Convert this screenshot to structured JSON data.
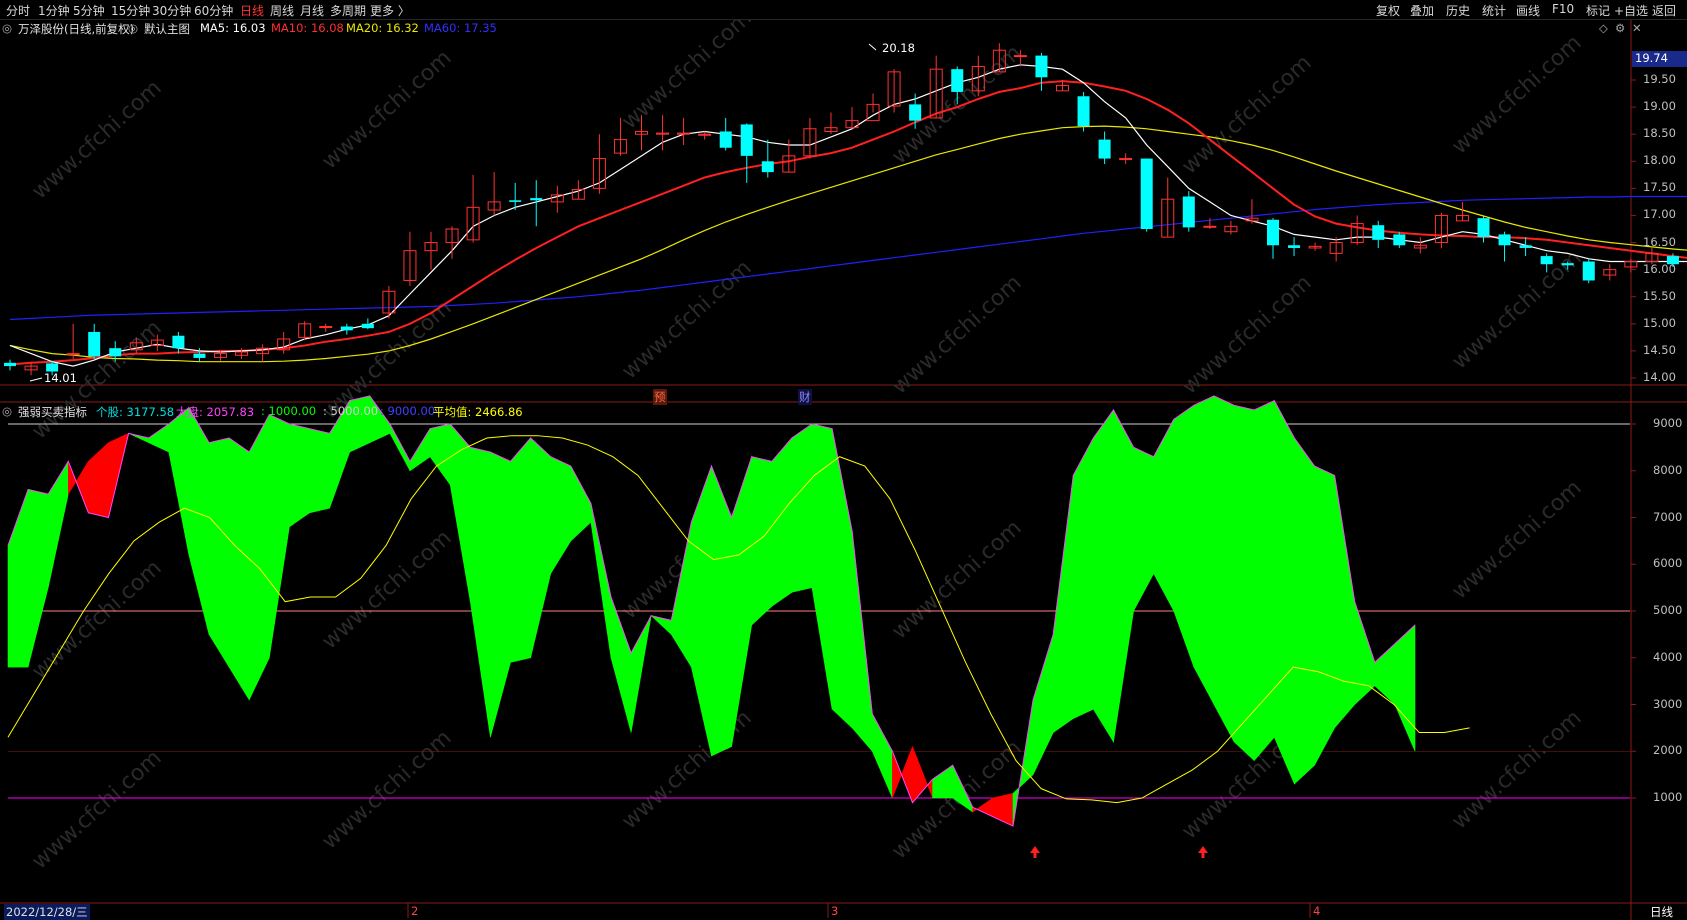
{
  "colors": {
    "up": "#ff3232",
    "down": "#00ffff",
    "ma5": "#ffffff",
    "ma10": "#ff2020",
    "ma20": "#e8e800",
    "ma60": "#2020ff",
    "green": "#00ff00",
    "red": "#ff0000",
    "magenta": "#ff00ff",
    "yellow": "#ffff00"
  },
  "toolbar": {
    "periods": [
      "分时",
      "1分钟",
      "5分钟",
      "15分钟",
      "30分钟",
      "60分钟",
      "日线",
      "周线",
      "月线",
      "多周期",
      "更多 〉"
    ],
    "active_period": "日线",
    "right": [
      "复权",
      "叠加",
      "历史",
      "统计",
      "画线",
      "F10",
      "标记",
      "+自选",
      "返回"
    ]
  },
  "main": {
    "title": "万泽股份(日线,前复权)",
    "template": "默认主图",
    "ma5": "MA5: 16.03",
    "ma10": "MA10: 16.08",
    "ma20": "MA20: 16.32",
    "ma60": "MA60: 17.35",
    "high_label": "20.18",
    "low_label": "14.01",
    "price_tag": "19.74",
    "marker_yu": "预",
    "marker_cai": "财",
    "y_ticks": [
      "19.50",
      "19.00",
      "18.50",
      "18.00",
      "17.50",
      "17.00",
      "16.50",
      "16.00",
      "15.50",
      "15.00",
      "14.50",
      "14.00"
    ]
  },
  "indicator": {
    "name": "强弱买卖指标",
    "gegu": "个股: 3177.58",
    "dapan": "大盘: 2057.83",
    "l1000": ": 1000.00",
    "l5000": ": 5000.00",
    "l9000": ": 9000.00",
    "avg": "平均值: 2466.86",
    "y_ticks": [
      "9000",
      "8000",
      "7000",
      "6000",
      "5000",
      "4000",
      "3000",
      "2000",
      "1000"
    ]
  },
  "bottom": {
    "date": "2022/12/28/三",
    "months": [
      "2",
      "3",
      "4"
    ],
    "period_tag": "日线"
  },
  "watermark": "www.cfchi.com",
  "chart_data": {
    "type": "candlestick",
    "ylim": [
      13.7,
      19.9
    ],
    "candles": [
      [
        14.28,
        14.22,
        14.34,
        14.14
      ],
      [
        14.15,
        14.22,
        14.3,
        14.05
      ],
      [
        14.27,
        14.12,
        14.32,
        14.05
      ],
      [
        14.45,
        14.45,
        15.0,
        14.35
      ],
      [
        14.85,
        14.4,
        15.0,
        14.35
      ],
      [
        14.55,
        14.4,
        14.68,
        14.3
      ],
      [
        14.52,
        14.65,
        14.75,
        14.45
      ],
      [
        14.6,
        14.7,
        14.8,
        14.5
      ],
      [
        14.78,
        14.55,
        14.85,
        14.45
      ],
      [
        14.45,
        14.37,
        14.55,
        14.3
      ],
      [
        14.38,
        14.45,
        14.5,
        14.32
      ],
      [
        14.42,
        14.48,
        14.55,
        14.35
      ],
      [
        14.45,
        14.55,
        14.62,
        14.3
      ],
      [
        14.52,
        14.72,
        14.85,
        14.45
      ],
      [
        14.75,
        15.0,
        15.05,
        14.7
      ],
      [
        14.95,
        14.95,
        15.0,
        14.85
      ],
      [
        14.95,
        14.88,
        15.0,
        14.8
      ],
      [
        15.0,
        14.92,
        15.1,
        14.9
      ],
      [
        15.2,
        15.6,
        15.7,
        15.1
      ],
      [
        15.8,
        16.35,
        16.7,
        15.7
      ],
      [
        16.35,
        16.5,
        16.7,
        16.0
      ],
      [
        16.5,
        16.75,
        16.8,
        16.2
      ],
      [
        16.55,
        17.15,
        17.75,
        16.5
      ],
      [
        17.1,
        17.25,
        17.8,
        17.0
      ],
      [
        17.28,
        17.25,
        17.6,
        17.1
      ],
      [
        17.32,
        17.28,
        17.65,
        16.8
      ],
      [
        17.25,
        17.38,
        17.55,
        17.05
      ],
      [
        17.3,
        17.48,
        17.65,
        17.3
      ],
      [
        17.5,
        18.05,
        18.5,
        17.4
      ],
      [
        18.15,
        18.4,
        18.8,
        18.1
      ],
      [
        18.5,
        18.55,
        18.85,
        18.2
      ],
      [
        18.5,
        18.52,
        18.85,
        18.2
      ],
      [
        18.5,
        18.52,
        18.8,
        18.3
      ],
      [
        18.48,
        18.5,
        18.55,
        18.4
      ],
      [
        18.55,
        18.25,
        18.8,
        18.2
      ],
      [
        18.68,
        18.1,
        18.7,
        17.6
      ],
      [
        18.0,
        17.8,
        18.4,
        17.7
      ],
      [
        17.8,
        18.1,
        18.4,
        17.8
      ],
      [
        18.1,
        18.6,
        18.8,
        18.05
      ],
      [
        18.55,
        18.62,
        18.9,
        18.5
      ],
      [
        18.62,
        18.75,
        19.0,
        18.6
      ],
      [
        18.75,
        19.05,
        19.25,
        18.9
      ],
      [
        19.02,
        19.65,
        19.7,
        18.9
      ],
      [
        19.05,
        18.75,
        19.25,
        18.6
      ],
      [
        18.8,
        19.7,
        19.95,
        18.8
      ],
      [
        19.7,
        19.28,
        19.75,
        19.05
      ],
      [
        19.3,
        19.75,
        19.95,
        19.2
      ],
      [
        19.65,
        20.05,
        20.18,
        19.65
      ],
      [
        19.95,
        19.95,
        20.05,
        19.75
      ],
      [
        19.95,
        19.55,
        20.0,
        19.3
      ],
      [
        19.3,
        19.4,
        19.5,
        19.3
      ],
      [
        19.2,
        18.65,
        19.28,
        18.55
      ],
      [
        18.4,
        18.05,
        18.55,
        17.95
      ],
      [
        18.05,
        18.05,
        18.15,
        17.95
      ],
      [
        18.05,
        16.75,
        18.05,
        16.7
      ],
      [
        16.6,
        17.3,
        17.7,
        16.6
      ],
      [
        17.35,
        16.78,
        17.45,
        16.7
      ],
      [
        16.8,
        16.8,
        16.95,
        16.75
      ],
      [
        16.7,
        16.8,
        16.9,
        16.65
      ],
      [
        16.9,
        16.95,
        17.3,
        16.85
      ],
      [
        16.92,
        16.45,
        16.95,
        16.2
      ],
      [
        16.45,
        16.4,
        16.6,
        16.25
      ],
      [
        16.4,
        16.43,
        16.5,
        16.35
      ],
      [
        16.3,
        16.5,
        16.6,
        16.15
      ],
      [
        16.5,
        16.85,
        17.0,
        16.45
      ],
      [
        16.82,
        16.55,
        16.9,
        16.4
      ],
      [
        16.65,
        16.45,
        16.7,
        16.4
      ],
      [
        16.4,
        16.45,
        16.6,
        16.3
      ],
      [
        16.5,
        17.0,
        17.05,
        16.4
      ],
      [
        16.9,
        17.0,
        17.25,
        16.9
      ],
      [
        16.95,
        16.6,
        16.98,
        16.5
      ],
      [
        16.65,
        16.45,
        16.7,
        16.15
      ],
      [
        16.45,
        16.4,
        16.6,
        16.25
      ],
      [
        16.25,
        16.1,
        16.3,
        15.95
      ],
      [
        16.12,
        16.08,
        16.15,
        16.0
      ],
      [
        16.15,
        15.8,
        16.2,
        15.75
      ],
      [
        15.9,
        16.0,
        16.1,
        15.8
      ],
      [
        16.05,
        16.15,
        16.2,
        15.95
      ],
      [
        16.15,
        16.3,
        16.4,
        16.1
      ],
      [
        16.25,
        16.1,
        16.3,
        16.05
      ],
      [
        16.15,
        16.0,
        16.25,
        15.95
      ],
      [
        15.95,
        15.85,
        15.95,
        15.65
      ]
    ],
    "ma5": [
      14.6,
      14.45,
      14.3,
      14.22,
      14.33,
      14.48,
      14.55,
      14.62,
      14.55,
      14.5,
      14.48,
      14.5,
      14.52,
      14.57,
      14.72,
      14.8,
      14.9,
      14.98,
      15.15,
      15.55,
      15.95,
      16.35,
      16.8,
      17.0,
      17.15,
      17.25,
      17.35,
      17.45,
      17.6,
      17.85,
      18.1,
      18.35,
      18.5,
      18.55,
      18.5,
      18.45,
      18.35,
      18.3,
      18.3,
      18.45,
      18.6,
      18.85,
      19.05,
      19.15,
      19.3,
      19.45,
      19.55,
      19.7,
      19.78,
      19.75,
      19.7,
      19.45,
      19.1,
      18.8,
      18.3,
      17.9,
      17.5,
      17.25,
      17.0,
      16.9,
      16.8,
      16.65,
      16.6,
      16.55,
      16.6,
      16.6,
      16.55,
      16.5,
      16.6,
      16.7,
      16.65,
      16.55,
      16.45,
      16.35,
      16.3,
      16.2,
      16.15,
      16.15,
      16.15,
      16.15,
      16.15,
      16.05
    ],
    "ma10": [
      14.25,
      14.28,
      14.3,
      14.33,
      14.37,
      14.42,
      14.45,
      14.45,
      14.47,
      14.48,
      14.5,
      14.5,
      14.52,
      14.55,
      14.6,
      14.67,
      14.72,
      14.78,
      14.85,
      15.0,
      15.2,
      15.45,
      15.7,
      15.95,
      16.18,
      16.4,
      16.6,
      16.8,
      16.95,
      17.1,
      17.25,
      17.4,
      17.55,
      17.7,
      17.8,
      17.88,
      17.95,
      18.0,
      18.08,
      18.15,
      18.25,
      18.4,
      18.55,
      18.72,
      18.88,
      19.0,
      19.15,
      19.28,
      19.35,
      19.45,
      19.48,
      19.45,
      19.38,
      19.3,
      19.15,
      18.95,
      18.7,
      18.4,
      18.1,
      17.8,
      17.5,
      17.2,
      16.98,
      16.85,
      16.78,
      16.72,
      16.68,
      16.65,
      16.63,
      16.62,
      16.6,
      16.6,
      16.58,
      16.55,
      16.5,
      16.45,
      16.4,
      16.35,
      16.3,
      16.25,
      16.2,
      16.08
    ],
    "ma20": [
      14.6,
      14.52,
      14.45,
      14.42,
      14.38,
      14.36,
      14.35,
      14.33,
      14.32,
      14.3,
      14.3,
      14.3,
      14.3,
      14.31,
      14.33,
      14.36,
      14.4,
      14.44,
      14.5,
      14.6,
      14.72,
      14.86,
      15.0,
      15.15,
      15.3,
      15.45,
      15.6,
      15.75,
      15.9,
      16.05,
      16.2,
      16.37,
      16.55,
      16.72,
      16.88,
      17.02,
      17.15,
      17.28,
      17.4,
      17.52,
      17.64,
      17.76,
      17.88,
      18.0,
      18.12,
      18.22,
      18.32,
      18.42,
      18.5,
      18.56,
      18.62,
      18.64,
      18.65,
      18.63,
      18.6,
      18.55,
      18.5,
      18.45,
      18.38,
      18.3,
      18.2,
      18.08,
      17.95,
      17.82,
      17.7,
      17.58,
      17.46,
      17.34,
      17.22,
      17.1,
      16.99,
      16.88,
      16.78,
      16.7,
      16.62,
      16.55,
      16.5,
      16.46,
      16.42,
      16.38,
      16.35,
      16.32
    ],
    "ma60": [
      15.08,
      15.1,
      15.12,
      15.14,
      15.16,
      15.17,
      15.18,
      15.19,
      15.2,
      15.21,
      15.22,
      15.23,
      15.24,
      15.25,
      15.26,
      15.27,
      15.28,
      15.29,
      15.3,
      15.31,
      15.32,
      15.34,
      15.36,
      15.38,
      15.41,
      15.44,
      15.47,
      15.5,
      15.54,
      15.58,
      15.62,
      15.67,
      15.72,
      15.77,
      15.82,
      15.87,
      15.92,
      15.97,
      16.02,
      16.07,
      16.12,
      16.17,
      16.22,
      16.27,
      16.32,
      16.37,
      16.42,
      16.47,
      16.52,
      16.57,
      16.62,
      16.67,
      16.71,
      16.75,
      16.79,
      16.83,
      16.87,
      16.91,
      16.95,
      16.99,
      17.03,
      17.07,
      17.11,
      17.14,
      17.17,
      17.2,
      17.22,
      17.24,
      17.26,
      17.28,
      17.29,
      17.3,
      17.31,
      17.32,
      17.33,
      17.34,
      17.34,
      17.35,
      17.35,
      17.35,
      17.35,
      17.35
    ],
    "indicator_ylim": [
      500,
      9950
    ],
    "gegu": [
      6400,
      7600,
      7500,
      8200,
      7100,
      7000,
      8800,
      8700,
      9000,
      9350,
      8600,
      8700,
      8400,
      9200,
      9000,
      8900,
      8800,
      9500,
      9600,
      9000,
      8200,
      8900,
      9000,
      8500,
      8400,
      8200,
      8700,
      8300,
      8100,
      7300,
      5300,
      4100,
      4900,
      4800,
      6900,
      8100,
      7000,
      8300,
      8200,
      8700,
      9000,
      8900,
      6700,
      2800,
      2000,
      900,
      1400,
      1700,
      800,
      600,
      400,
      3100,
      4500,
      7900,
      8700,
      9300,
      8500,
      8300,
      9100,
      9400,
      9600,
      9400,
      9300,
      9500,
      8700,
      8100,
      7900,
      5200,
      3900,
      4300,
      4700,
      3200,
      3200
    ],
    "dapan": [
      3800,
      3800,
      5500,
      7500,
      8200,
      8600,
      8800,
      8600,
      8400,
      6200,
      4500,
      3800,
      3100,
      4000,
      6800,
      7100,
      7200,
      8400,
      8600,
      8800,
      8000,
      8300,
      7700,
      5200,
      2300,
      3900,
      4000,
      5800,
      6500,
      6900,
      4000,
      2400,
      4900,
      4500,
      3800,
      1900,
      2100,
      4700,
      5100,
      5400,
      5500,
      2900,
      2500,
      2000,
      1000,
      2100,
      1000,
      1000,
      700,
      1000,
      1100,
      1500,
      2400,
      2700,
      2900,
      2200,
      5000,
      5800,
      5000,
      3800,
      3000,
      2200,
      1800,
      2300,
      1300,
      1700,
      2500,
      3000,
      3400,
      3000,
      2000
    ],
    "avg": [
      2300,
      3200,
      4100,
      5000,
      5800,
      6500,
      6900,
      7200,
      7000,
      6400,
      5900,
      5200,
      5300,
      5300,
      5700,
      6400,
      7400,
      8100,
      8450,
      8700,
      8750,
      8750,
      8700,
      8550,
      8300,
      7900,
      7200,
      6500,
      6100,
      6200,
      6600,
      7300,
      7900,
      8300,
      8100,
      7400,
      6300,
      5100,
      3900,
      2800,
      1800,
      1200,
      980,
      960,
      900,
      1000,
      1300,
      1600,
      2000,
      2600,
      3200,
      3800,
      3700,
      3500,
      3400,
      3000,
      2400,
      2400,
      2500
    ]
  }
}
